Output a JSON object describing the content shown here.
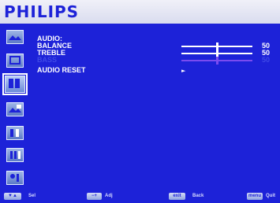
{
  "header": {
    "brand": "PHILIPS"
  },
  "sidebar": {
    "items": [
      {
        "icon": "picture-icon"
      },
      {
        "icon": "screen-icon"
      },
      {
        "icon": "audio-icon",
        "active": true
      },
      {
        "icon": "pip-icon"
      },
      {
        "icon": "config1-icon"
      },
      {
        "icon": "config2-icon"
      },
      {
        "icon": "advanced-option-icon"
      }
    ]
  },
  "menu": {
    "title": "AUDIO:",
    "items": [
      {
        "label": "BALANCE",
        "value": "50",
        "level": 0.5,
        "enabled": true
      },
      {
        "label": "TREBLE",
        "value": "50",
        "level": 0.5,
        "enabled": true
      },
      {
        "label": "BASS",
        "value": "50",
        "level": 0.5,
        "enabled": false
      }
    ],
    "reset": {
      "label": "AUDIO RESET",
      "arrow": "►"
    }
  },
  "footer": {
    "sel": {
      "key": "▼▲",
      "label": "Sel"
    },
    "adj": {
      "key": "−+",
      "label": "Adj"
    },
    "back": {
      "key": "exit",
      "label": "Back"
    },
    "quit": {
      "key": "menu",
      "label": "Quit"
    }
  },
  "colors": {
    "background": "#1d22d8",
    "header": "#e8eaf5",
    "text": "#ffffff",
    "disabled": "#3f49e6"
  }
}
